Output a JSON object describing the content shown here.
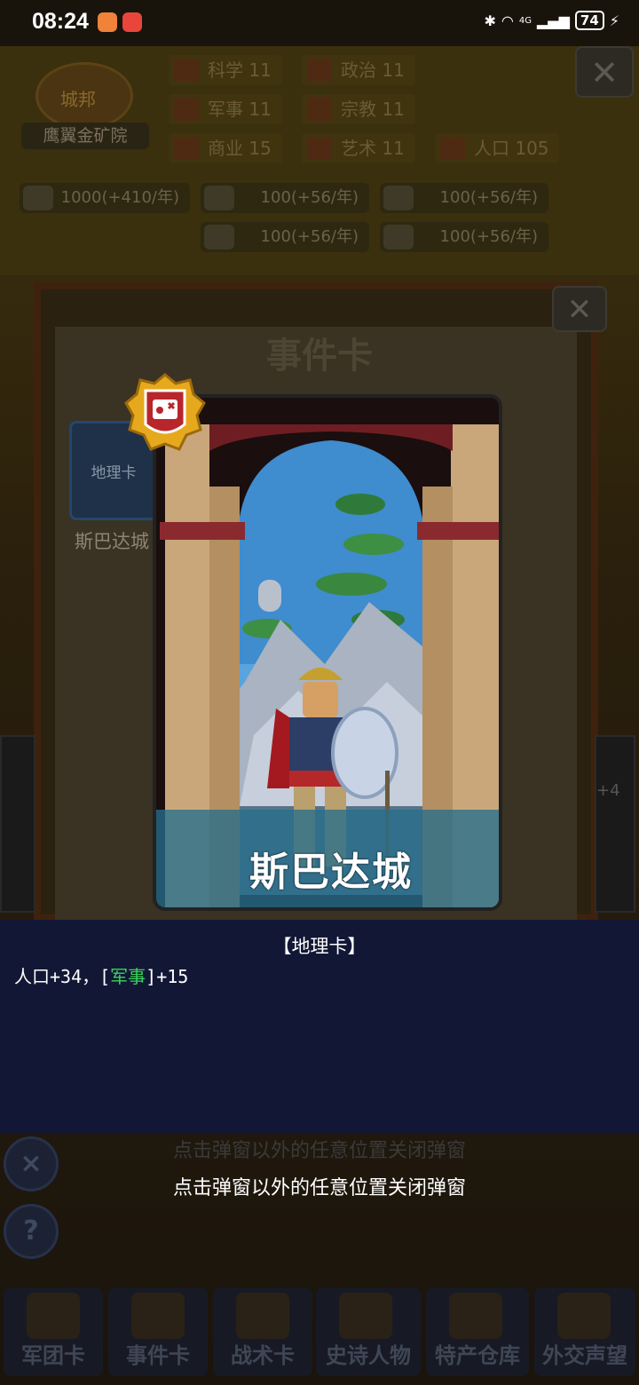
{
  "status_bar": {
    "time": "08:24",
    "battery": "74",
    "network": "4G"
  },
  "city": {
    "badge_label": "城邦",
    "name": "鹰翼金矿院"
  },
  "stats": [
    {
      "label": "科学",
      "value": "11",
      "icon": "planet-icon"
    },
    {
      "label": "政治",
      "value": "11",
      "icon": "temple-icon"
    },
    {
      "label": "军事",
      "value": "11",
      "icon": "crossed-swords-icon"
    },
    {
      "label": "宗教",
      "value": "11",
      "icon": "fleur-icon"
    },
    {
      "label": "商业",
      "value": "15",
      "icon": "scales-icon"
    },
    {
      "label": "艺术",
      "value": "11",
      "icon": "lyre-icon"
    },
    {
      "label": "人口",
      "value": "105",
      "icon": "person-icon"
    }
  ],
  "resources": [
    {
      "text": "1000(+410/年)",
      "icon": "gold-coins-icon"
    },
    {
      "text": "100(+56/年)",
      "icon": "wood-icon"
    },
    {
      "text": "100(+56/年)",
      "icon": "ore-icon"
    },
    {
      "text": "100(+56/年)",
      "icon": "cloth-icon"
    },
    {
      "text": "100(+56/年)",
      "icon": "meat-icon"
    }
  ],
  "event_dialog": {
    "title": "事件卡",
    "mini_card_label": "地理卡",
    "mini_card_name": "斯巴达城"
  },
  "card": {
    "name": "斯巴达城",
    "badge_icon": "map-badge-icon"
  },
  "info": {
    "type": "【地理卡】",
    "effect_prefix": "人口+34，[",
    "effect_highlight": "军事",
    "effect_suffix": "]+15"
  },
  "hints": {
    "dim": "点击弹窗以外的任意位置关闭弹窗",
    "main": "点击弹窗以外的任意位置关闭弹窗"
  },
  "side_right_text": "+4",
  "bottom_nav": [
    {
      "label": "军团卡",
      "icon": "helmet-icon"
    },
    {
      "label": "事件卡",
      "icon": "scroll-icon"
    },
    {
      "label": "战术卡",
      "icon": "shield-emblem-icon"
    },
    {
      "label": "史诗人物",
      "icon": "crown-icon"
    },
    {
      "label": "特产仓库",
      "icon": "chest-icon"
    },
    {
      "label": "外交声望",
      "icon": "letter-icon"
    }
  ],
  "colors": {
    "info_panel_bg": "#121735",
    "highlight_green": "#39d45a",
    "card_band": "#266e8c"
  }
}
